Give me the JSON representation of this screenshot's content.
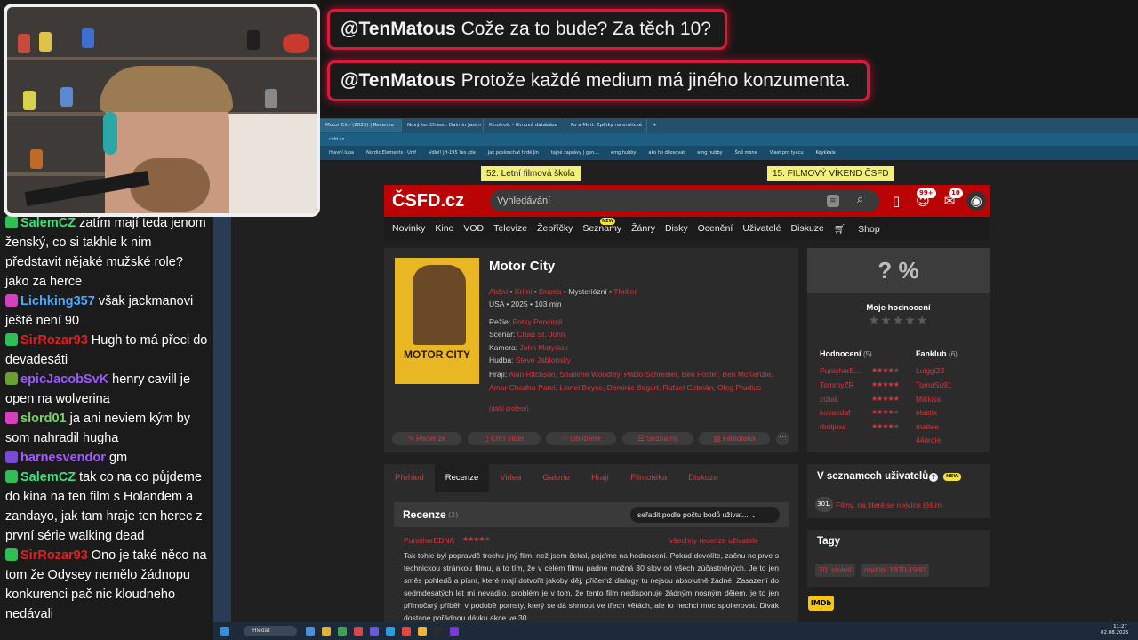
{
  "overlay": {
    "messages": [
      {
        "user": "@TenMatous",
        "text": "Cože za to bude? Za těch 10?"
      },
      {
        "user": "@TenMatous",
        "text": "Protože každé medium má jiného konzumenta."
      }
    ]
  },
  "chat": {
    "lines": [
      {
        "user": "SalemCZ",
        "user_color": "#3ee07a",
        "text": "zatím mají teda jenom ženský, co si takhle k nim představit nějaké mužské role? jako za herce"
      },
      {
        "user": "Lichking357",
        "user_color": "#4aa8ff",
        "text": "však jackmanovi ještě není 90"
      },
      {
        "user": "SirRozar93",
        "user_color": "#e02020",
        "text": "Hugh to má přeci do devadesáti"
      },
      {
        "user": "epicJacobSvK",
        "user_color": "#9b59ff",
        "text": "henry cavill je open na wolverina"
      },
      {
        "user": "slord01",
        "user_color": "#7ad16a",
        "text": "ja ani neviem kým by som nahradil hugha"
      },
      {
        "user": "harnesvendor",
        "user_color": "#a45cff",
        "text": "gm"
      },
      {
        "user": "SalemCZ",
        "user_color": "#3ee07a",
        "text": "tak co na co půjdeme do kina na ten film s Holandem a zandayo, jak tam hraje ten herec z první série walking dead"
      },
      {
        "user": "SirRozar93",
        "user_color": "#e02020",
        "text": "Ono je také něco na tom že Odysey nemělo žádnopu konkurenci pač nic kloudneho nedávali"
      }
    ]
  },
  "browser": {
    "tabs": [
      "Motor City (2025) | Recenze",
      "Nový ter Chassi: Dalmin Jasón F",
      "Kinotroic - filmová databáze",
      "Po a Mati: Zpětky na erotické",
      "+"
    ],
    "address": "csfd.cz",
    "bookmarks": [
      "Hlavní lupa",
      "Nordic Elements - Unif",
      "Vdlol! JH-195 Yes zde",
      "Jak poslouchat hrdé Jin",
      "tajné zaprávy | gen...",
      "emg hubby",
      "ako ho dkosovat",
      "emg hubby",
      "Šně mone",
      "Vlast pro tyacu",
      "Koykkale"
    ]
  },
  "promos": {
    "left": "52. Letní filmová škola",
    "right": "15. FILMOVÝ VÍKEND ČSFD"
  },
  "csfd": {
    "logo": "ČSFD.cz",
    "search_placeholder": "Vyhledávání",
    "badge_notifications": "99+",
    "badge_messages": "10",
    "nav": [
      "Novinky",
      "Kino",
      "VOD",
      "Televize",
      "Žebříčky",
      "Seznamy",
      "Žánry",
      "Disky",
      "Ocenění",
      "Uživatelé",
      "Diskuze",
      "Shop"
    ],
    "nav_new": "NEW"
  },
  "film": {
    "title": "Motor City",
    "poster_text": "MOTOR CITY",
    "genres": [
      "Akční",
      "Krimi",
      "Drama",
      "Mysteriózní",
      "Thriller"
    ],
    "origin": "USA • 2025 • 103 min",
    "rezie_label": "Režie:",
    "rezie": "Potsy Ponciroli",
    "scenar_label": "Scénář:",
    "scenar": "Chad St. John",
    "kamera_label": "Kamera:",
    "kamera": "John Matysiak",
    "hudba_label": "Hudba:",
    "hudba": "Steve Jablonsky",
    "hraji_label": "Hrají:",
    "hraji": "Alan Ritchson, Shailene Woodley, Pablo Schreiber, Ben Foster, Ben McKenzie, Amar Chadha-Patel, Lionel Boyce, Dominic Bogart, Rafael Cebrián, Oleg Prudius",
    "dalsi": "(další profese)",
    "actions": [
      "Recenze",
      "Chci vidět",
      "Oblíbené",
      "Seznamy",
      "Filmotéka"
    ]
  },
  "rating": {
    "percent": "? %",
    "moje": "Moje hodnocení",
    "hodnoceni_label": "Hodnocení",
    "hodnoceni_count": "(5)",
    "fanklub_label": "Fanklub",
    "fanklub_count": "(6)",
    "raters": [
      {
        "name": "PunisherE...",
        "stars": 4
      },
      {
        "name": "TommyZR",
        "stars": 5
      },
      {
        "name": "ziziak",
        "stars": 5
      },
      {
        "name": "kovandaf",
        "stars": 4
      },
      {
        "name": "rbotjoxs",
        "stars": 4
      }
    ],
    "fanklub": [
      "Luiggi23",
      "TomaSu91",
      "Mikkiss",
      "elastik",
      "mattee",
      "44ordie"
    ]
  },
  "subtabs": [
    "Přehled",
    "Recenze",
    "Videa",
    "Galerie",
    "Hrají",
    "Filmotéka",
    "Diskuze"
  ],
  "reviews": {
    "title": "Recenze",
    "count": "(2)",
    "sort": "seřadit podle počtu bodů uživat...",
    "user": "PunisherEDNA",
    "stars": 4,
    "all_link": "všechny recenze uživatele",
    "text": "Tak tohle byl popravdě trochu jiný film, než jsem čekal, pojďme na hodnocení. Pokud dovolíte, začnu nejprve s technickou stránkou filmu, a to tím, že v celém filmu padne možná 30 slov od všech zúčastněných. Je to jen směs pohledů a písní, které mají dotvořit jakoby děj, přičemž dialogy tu nejsou absolutně žádné. Zasazení do sedmdesátých let mi nevadilo, problém je v tom, že tento film nedisponuje žádným nosným dějem, je to jen přímočarý příběh v podobě pomsty, který se dá shrnout ve třech větách, ale to nechci moc spoilerovat. Divák dostane pořádnou dávku akce ve 30"
  },
  "lists": {
    "title": "V seznamech uživatelů",
    "new": "NEW",
    "num": "301.",
    "link": "Filmy, na které se nejvíce těším"
  },
  "tags": {
    "title": "Tagy",
    "items": [
      "20. století",
      "období 1970-1980"
    ]
  },
  "imdb": "IMDb",
  "taskbar": {
    "search": "Hledat",
    "time": "11:27",
    "date": "02.08.2025"
  }
}
